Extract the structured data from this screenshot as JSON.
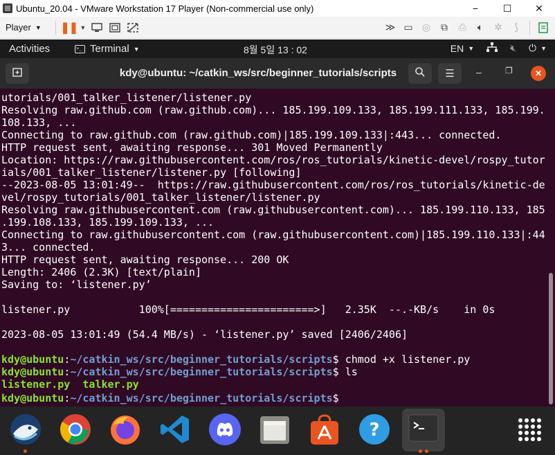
{
  "vmware": {
    "window_title": "Ubuntu_20.04 - VMware Workstation 17 Player (Non-commercial use only)",
    "player_menu": "Player",
    "win_minimize": "−",
    "win_maximize": "☐",
    "win_close": "✕"
  },
  "gnome": {
    "activities": "Activities",
    "app_menu": "Terminal",
    "clock": "8월 5일 13 : 02",
    "input_language": "EN"
  },
  "terminal": {
    "title": "kdy@ubuntu: ~/catkin_ws/src/beginner_tutorials/scripts",
    "output_lines": [
      "utorials/001_talker_listener/listener.py",
      "Resolving raw.github.com (raw.github.com)... 185.199.109.133, 185.199.111.133, 185.199.",
      "108.133, ...",
      "Connecting to raw.github.com (raw.github.com)|185.199.109.133|:443... connected.",
      "HTTP request sent, awaiting response... 301 Moved Permanently",
      "Location: https://raw.githubusercontent.com/ros/ros_tutorials/kinetic-devel/rospy_tutor",
      "ials/001_talker_listener/listener.py [following]",
      "--2023-08-05 13:01:49--  https://raw.githubusercontent.com/ros/ros_tutorials/kinetic-de",
      "vel/rospy_tutorials/001_talker_listener/listener.py",
      "Resolving raw.githubusercontent.com (raw.githubusercontent.com)... 185.199.110.133, 185",
      ".199.108.133, 185.199.109.133, ...",
      "Connecting to raw.githubusercontent.com (raw.githubusercontent.com)|185.199.110.133|:44",
      "3... connected.",
      "HTTP request sent, awaiting response... 200 OK",
      "Length: 2406 (2.3K) [text/plain]",
      "Saving to: ‘listener.py’",
      "",
      "listener.py           100%[=======================>]   2.35K  --.-KB/s    in 0s",
      "",
      "2023-08-05 13:01:49 (54.4 MB/s) - ‘listener.py’ saved [2406/2406]",
      ""
    ],
    "prompt_user": "kdy@ubuntu",
    "prompt_colon": ":",
    "prompt_path": "~/catkin_ws/src/beginner_tutorials/scripts",
    "prompt_dollar": "$",
    "cmd1": " chmod +x listener.py",
    "cmd2": " ls",
    "ls_listener": "listener.py",
    "ls_talker": "talker.py"
  },
  "dock": {
    "apps": [
      "Shotwell",
      "Google Chrome",
      "Firefox",
      "Visual Studio Code",
      "Discord",
      "Files",
      "Ubuntu Software",
      "Help",
      "Terminal",
      "Show Applications"
    ]
  },
  "colors": {
    "terminal_bg": "#300a24",
    "prompt_user": "#8ae234",
    "prompt_path": "#729fcf",
    "ubuntu_orange": "#e95420"
  }
}
